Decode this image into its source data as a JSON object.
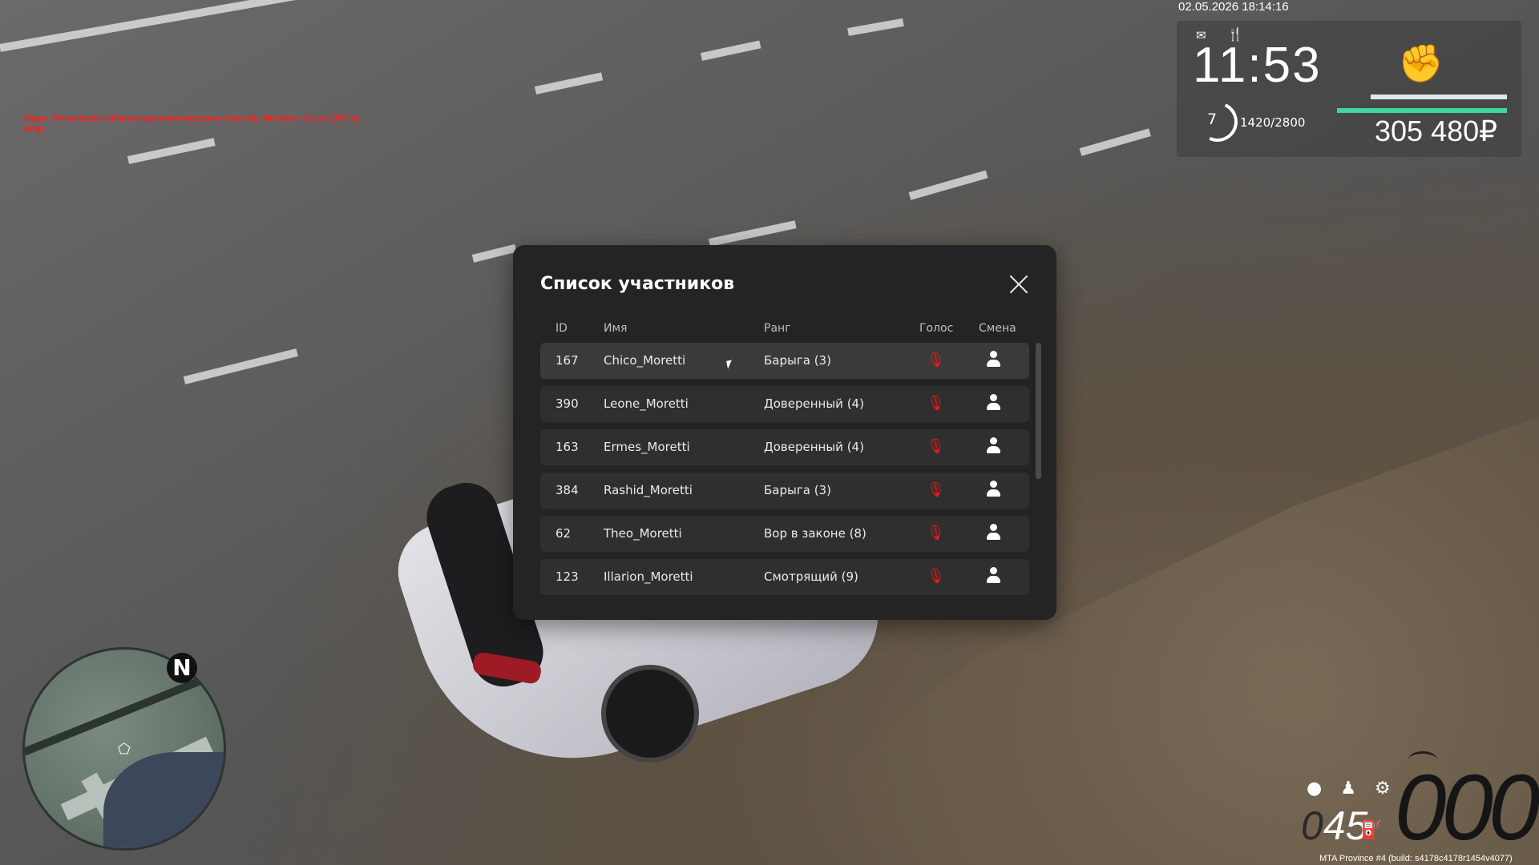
{
  "killfeed": {
    "line1": "Diego_Provenzano забанен администратором Anatoliy_Nesterov (3 шт.) (PC by",
    "line2": "ATM)"
  },
  "hud": {
    "datetime": "02.05.2026 18:14:16",
    "time": "11:53",
    "level": "7",
    "xp": "1420/2800",
    "money": "305 480₽",
    "mail_icon": "✉",
    "food_icon": "🍴",
    "fist_icon": "✊",
    "health_fraction": 1.0,
    "armor_fraction": 1.0,
    "accent": "#3fd6a0"
  },
  "minimap": {
    "north_label": "N",
    "player_icon": "⬠"
  },
  "speedometer": {
    "speed": "000",
    "fuel_prefix": "0",
    "fuel_value": "45",
    "icons": [
      "●",
      "♟",
      "⚙"
    ],
    "fuel_icon": "⛽"
  },
  "build": "MTA Province #4 (build: s4178c4178r1454v4077)",
  "modal": {
    "title": "Список участников",
    "columns": {
      "id": "ID",
      "name": "Имя",
      "rank": "Ранг",
      "voice": "Голос",
      "shift": "Смена"
    },
    "rows": [
      {
        "id": "167",
        "name": "Chico_Moretti",
        "rank": "Барыга (3)"
      },
      {
        "id": "390",
        "name": "Leone_Moretti",
        "rank": "Доверенный (4)"
      },
      {
        "id": "163",
        "name": "Ermes_Moretti",
        "rank": "Доверенный (4)"
      },
      {
        "id": "384",
        "name": "Rashid_Moretti",
        "rank": "Барыга (3)"
      },
      {
        "id": "62",
        "name": "Theo_Moretti",
        "rank": "Вор в законе (8)"
      },
      {
        "id": "123",
        "name": "Illarion_Moretti",
        "rank": "Смотрящий (9)"
      }
    ],
    "voice_icon": "🎙",
    "voice_color": "#e31b1b"
  }
}
